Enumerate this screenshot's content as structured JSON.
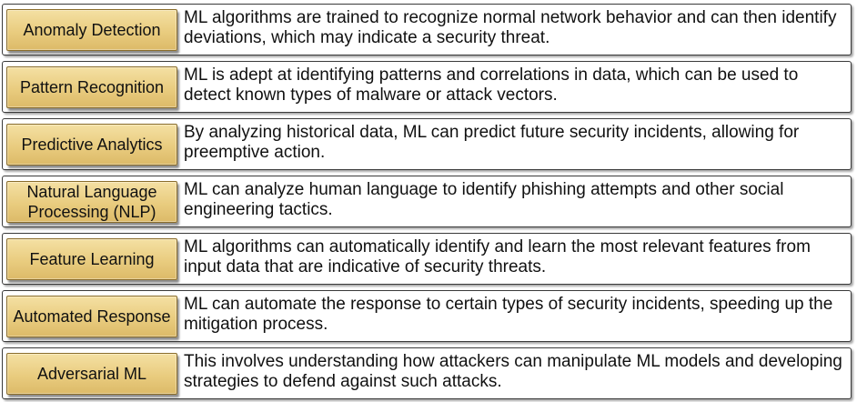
{
  "items": [
    {
      "term": "Anomaly Detection",
      "description": "ML algorithms are trained to recognize normal network behavior and can then identify deviations, which may indicate a security threat."
    },
    {
      "term": "Pattern Recognition",
      "description": "ML is adept at identifying patterns and correlations in data, which can be used to detect known types of malware or attack vectors."
    },
    {
      "term": "Predictive Analytics",
      "description": "By analyzing historical data, ML can predict future security incidents, allowing for preemptive action."
    },
    {
      "term": "Natural Language Processing (NLP)",
      "description": "ML can analyze human language to identify phishing attempts and other social engineering tactics."
    },
    {
      "term": "Feature Learning",
      "description": "ML algorithms can automatically identify and learn the most relevant features from input data that are indicative of security threats."
    },
    {
      "term": "Automated Response",
      "description": "ML can automate the response to certain types of security incidents, speeding up the mitigation process."
    },
    {
      "term": "Adversarial ML",
      "description": "This involves understanding how attackers can manipulate ML models and developing strategies to defend against such attacks."
    }
  ]
}
